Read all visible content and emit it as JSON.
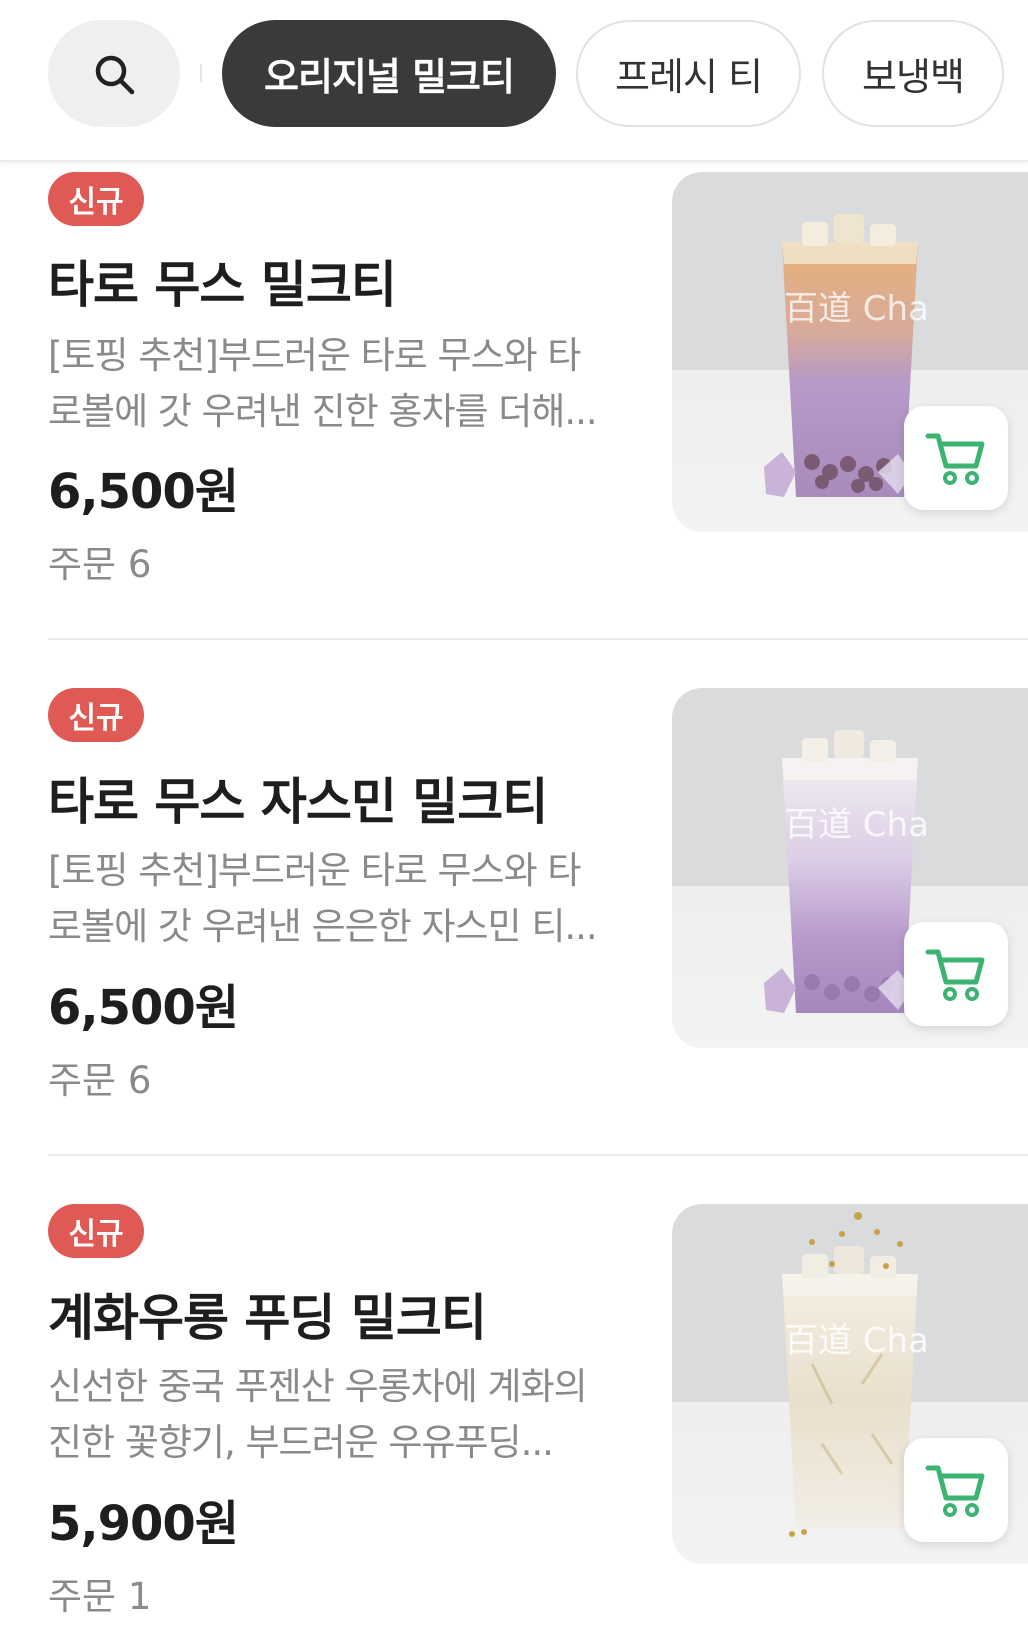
{
  "search": {
    "icon": "search-icon"
  },
  "chips": [
    {
      "label": "오리지널 밀크티",
      "active": true
    },
    {
      "label": "프레시 티",
      "active": false
    },
    {
      "label": "보냉백",
      "active": false
    }
  ],
  "items": [
    {
      "badge": "신규",
      "name": "타로 무스 밀크티",
      "desc_line1": "[토핑 추천]부드러운 타로 무스와 타",
      "desc_line2": "로볼에 갓 우려낸 진한 홍차를 더해...",
      "price": "6,500원",
      "orders": "주문 6",
      "image_label": "百道 Cha"
    },
    {
      "badge": "신규",
      "name": "타로 무스 자스민 밀크티",
      "desc_line1": "[토핑 추천]부드러운 타로 무스와 타",
      "desc_line2": "로볼에 갓 우려낸 은은한 자스민 티...",
      "price": "6,500원",
      "orders": "주문 6",
      "image_label": "百道 Cha"
    },
    {
      "badge": "신규",
      "name": "계화우롱 푸딩 밀크티",
      "desc_line1": "신선한 중국 푸젠산 우롱차에 계화의",
      "desc_line2": "진한 꽃향기, 부드러운 우유푸딩...",
      "price": "5,900원",
      "orders": "주문 1",
      "image_label": "百道 Cha"
    }
  ],
  "colors": {
    "badge": "#e05a55",
    "active_chip": "#3a3a3a",
    "cart_icon": "#3cb371"
  }
}
